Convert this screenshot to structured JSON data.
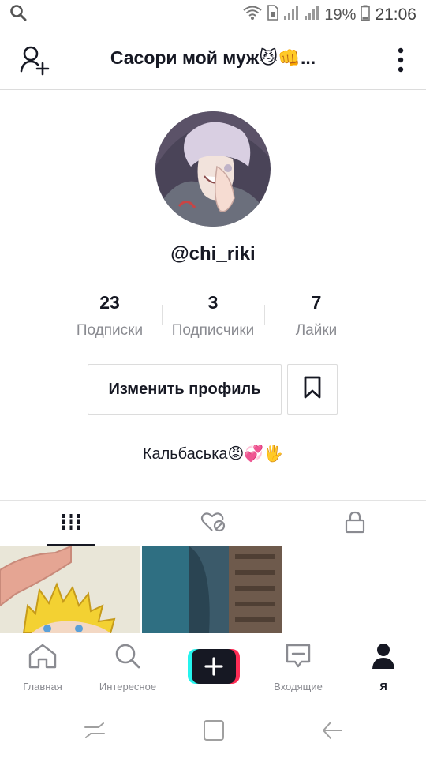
{
  "status_bar": {
    "battery_pct": "19%",
    "time": "21:06"
  },
  "header": {
    "title": "Сасори мой муж😼👊..."
  },
  "profile": {
    "username": "@chi_riki",
    "stats": [
      {
        "value": "23",
        "label": "Подписки"
      },
      {
        "value": "3",
        "label": "Подписчики"
      },
      {
        "value": "7",
        "label": "Лайки"
      }
    ],
    "edit_label": "Изменить профиль",
    "bio": "Кальбаська😡💞🖐"
  },
  "tabs": {
    "active": "videos",
    "items": [
      "videos-grid-icon",
      "liked-hidden-icon",
      "lock-icon"
    ]
  },
  "bottom_nav": {
    "home": "Главная",
    "discover": "Интересное",
    "inbox": "Входящие",
    "me": "Я"
  },
  "colors": {
    "text": "#161823",
    "secondary": "#8a8b91",
    "create_cyan": "#25f4ee",
    "create_red": "#fe2c55"
  }
}
